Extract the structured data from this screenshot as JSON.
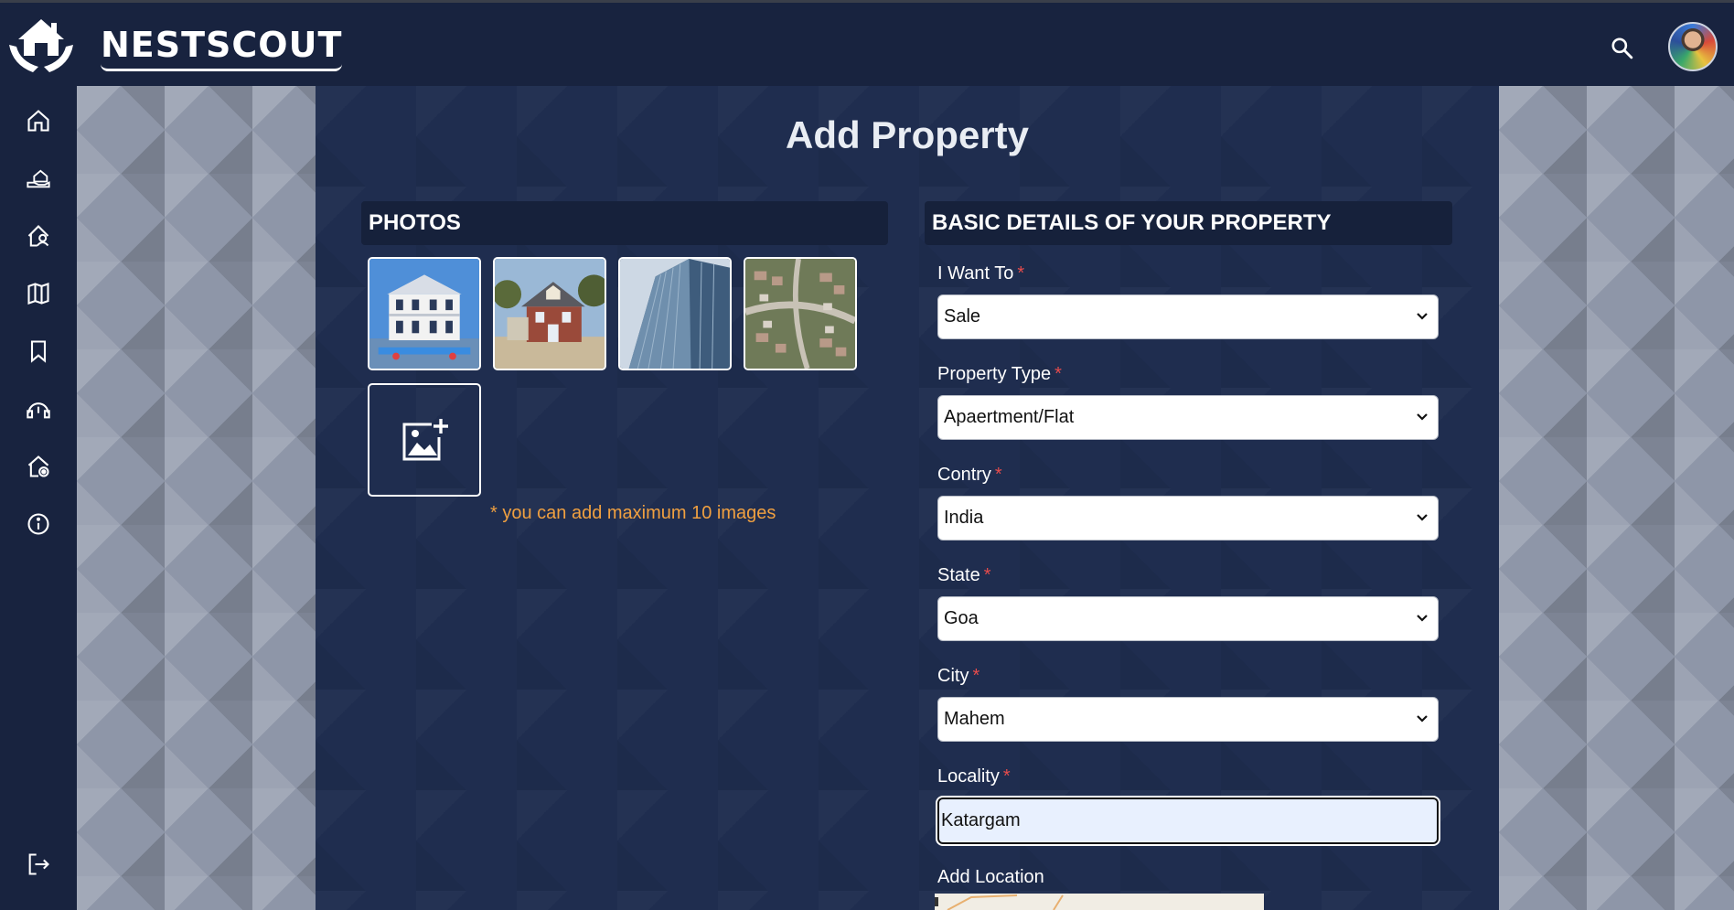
{
  "header": {
    "brand": "NESTSCOUT"
  },
  "sidebar": {
    "icons": [
      "home-icon",
      "hand-house-icon",
      "house-user-icon",
      "map-icon",
      "bookmark-icon",
      "support-icon",
      "house-settings-icon",
      "info-icon",
      "logout-icon"
    ]
  },
  "main": {
    "title": "Add Property",
    "photos": {
      "header": "PHOTOS",
      "note": "* you can add maximum 10 images"
    },
    "details": {
      "header": "BASIC DETAILS OF YOUR PROPERTY",
      "fields": [
        {
          "label": "I Want To",
          "required": "*",
          "value": "Sale"
        },
        {
          "label": "Property Type",
          "required": "*",
          "value": "Apaertment/Flat"
        },
        {
          "label": "Contry",
          "required": "*",
          "value": "India"
        },
        {
          "label": "State",
          "required": "*",
          "value": "Goa"
        },
        {
          "label": "City",
          "required": "*",
          "value": "Mahem"
        },
        {
          "label": "Locality",
          "required": "*",
          "value": "Katargam"
        }
      ],
      "add_location": "Add Location"
    }
  },
  "colors": {
    "topbar": "#18233f",
    "main_bg": "#1f2d4f",
    "note": "#f0a040",
    "required": "#e74c4c"
  }
}
